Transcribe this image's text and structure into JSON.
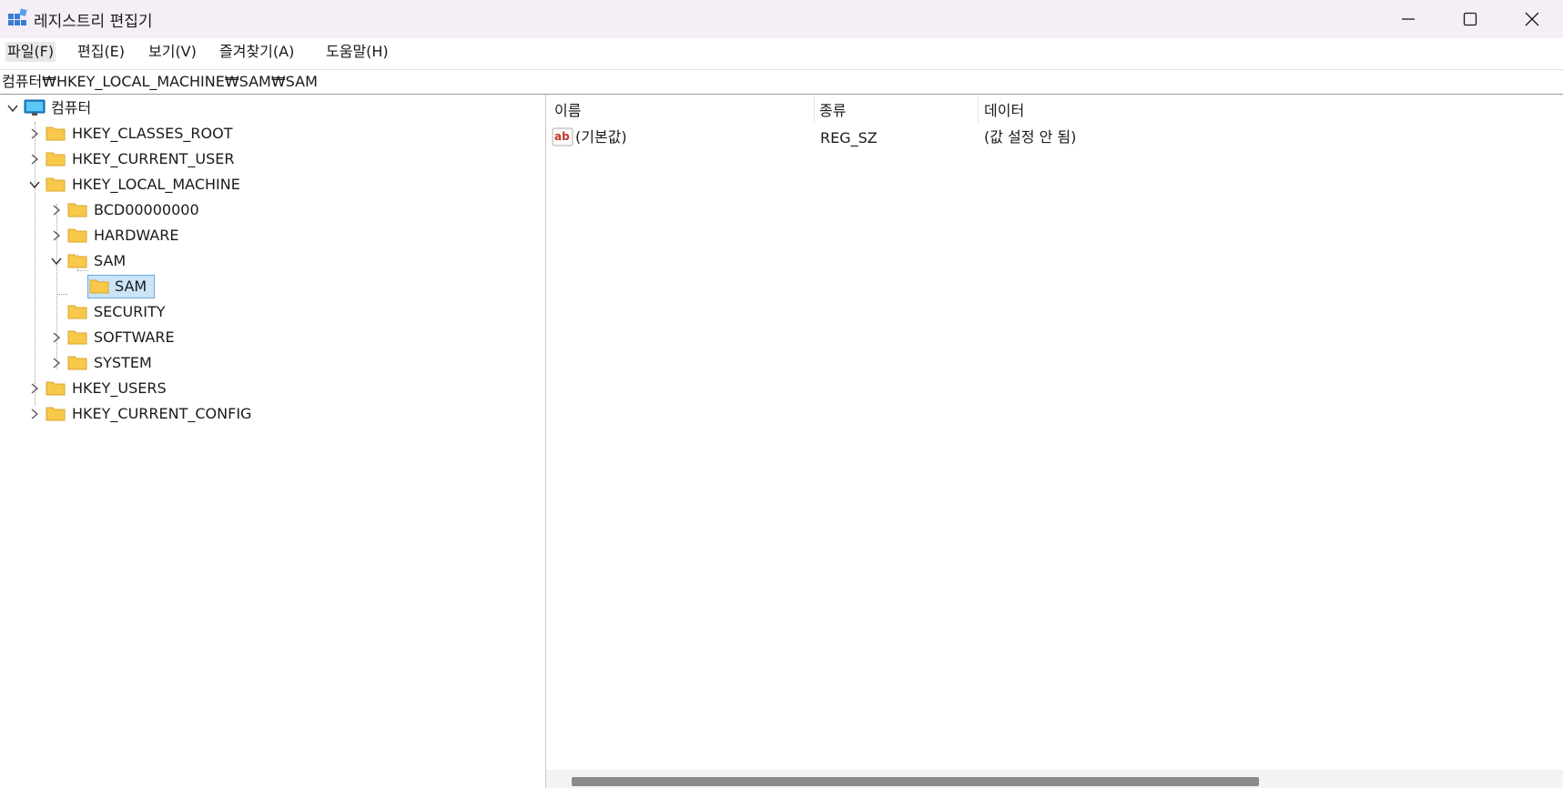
{
  "window": {
    "title": "레지스트리 편집기"
  },
  "menu": [
    "파일(F)",
    "편집(E)",
    "보기(V)",
    "즐겨찾기(A)",
    "도움말(H)"
  ],
  "address": "컴퓨터₩HKEY_LOCAL_MACHINE₩SAM₩SAM",
  "tree": {
    "root": "컴퓨터",
    "nodes": [
      "HKEY_CLASSES_ROOT",
      "HKEY_CURRENT_USER",
      "HKEY_LOCAL_MACHINE",
      "BCD00000000",
      "HARDWARE",
      "SAM",
      "SAM",
      "SECURITY",
      "SOFTWARE",
      "SYSTEM",
      "HKEY_USERS",
      "HKEY_CURRENT_CONFIG"
    ]
  },
  "list": {
    "columns": [
      "이름",
      "종류",
      "데이터"
    ],
    "rows": [
      {
        "name": "(기본값)",
        "type": "REG_SZ",
        "data": "(값 설정 안 됨)"
      }
    ]
  },
  "icons": {
    "app": "registry-editor-icon",
    "value": "string-value-icon",
    "computer": "computer-icon",
    "folder": "folder-icon"
  },
  "colors": {
    "titlebar": "#f6eef6",
    "selection": "#cce4f7",
    "folder": "#f7c84a"
  }
}
